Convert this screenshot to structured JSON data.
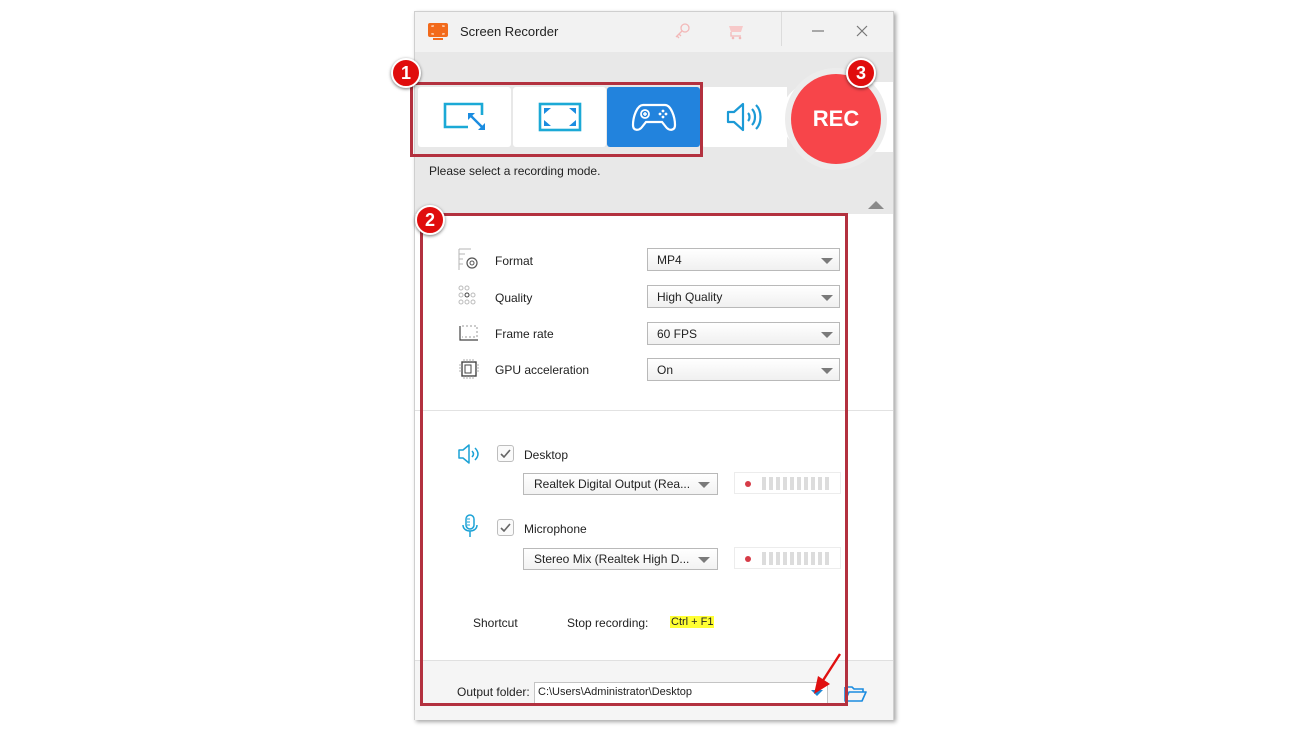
{
  "window": {
    "title": "Screen Recorder",
    "titlebar_icons": [
      "app-logo-icon",
      "key-icon",
      "cart-icon",
      "minimize-icon",
      "close-icon"
    ]
  },
  "mode_bar": {
    "modes": [
      {
        "name": "region",
        "icon": "region-resize-icon",
        "selected": false
      },
      {
        "name": "fullscreen",
        "icon": "fullscreen-icon",
        "selected": false
      },
      {
        "name": "game",
        "icon": "gamepad-icon",
        "selected": true
      },
      {
        "name": "audio",
        "icon": "speaker-icon",
        "selected": false
      }
    ],
    "rec_label": "REC",
    "hint": "Please select a recording mode.",
    "accent_color": "#2283dd",
    "rec_color": "#f7454a"
  },
  "settings": {
    "rows": [
      {
        "label": "Format",
        "value": "MP4",
        "icon": "format-gear-icon"
      },
      {
        "label": "Quality",
        "value": "High Quality",
        "icon": "quality-dots-icon"
      },
      {
        "label": "Frame rate",
        "value": "60 FPS",
        "icon": "frame-rate-icon"
      },
      {
        "label": "GPU acceleration",
        "value": "On",
        "icon": "gpu-chip-icon"
      }
    ]
  },
  "audio": {
    "desktop": {
      "label": "Desktop",
      "checked": true,
      "device": "Realtek Digital Output (Rea...",
      "icon": "speaker-icon"
    },
    "microphone": {
      "label": "Microphone",
      "checked": true,
      "device": "Stereo Mix (Realtek High D...",
      "icon": "microphone-icon"
    }
  },
  "shortcut": {
    "label": "Shortcut",
    "stop_label": "Stop recording:",
    "stop_key": "Ctrl + F1"
  },
  "output": {
    "label": "Output folder:",
    "path": "C:\\Users\\Administrator\\Desktop"
  },
  "annotations": {
    "badges": [
      "1",
      "2",
      "3"
    ],
    "color": "#b3313f"
  }
}
